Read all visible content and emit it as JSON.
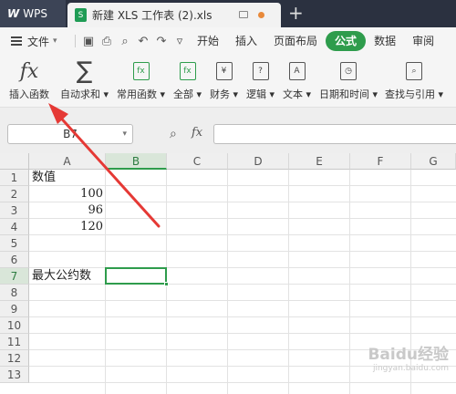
{
  "titlebar": {
    "app_label": "WPS",
    "doc_tab_title": "新建 XLS 工作表 (2).xls",
    "new_tab_symbol": "+"
  },
  "menubar": {
    "file_label": "文件",
    "items": [
      "开始",
      "插入",
      "页面布局",
      "公式",
      "数据",
      "审阅"
    ],
    "active_item": "公式",
    "active_color": "#2e9c4c"
  },
  "ribbon": {
    "buttons": [
      {
        "label": "插入函数",
        "icon": "fx-icon"
      },
      {
        "label": "自动求和",
        "icon": "sigma-icon"
      },
      {
        "label": "常用函数",
        "icon": "common-functions-icon"
      },
      {
        "label": "全部",
        "icon": "all-functions-icon"
      },
      {
        "label": "财务",
        "icon": "finance-icon"
      },
      {
        "label": "逻辑",
        "icon": "logic-icon"
      },
      {
        "label": "文本",
        "icon": "text-icon"
      },
      {
        "label": "日期和时间",
        "icon": "clock-icon"
      },
      {
        "label": "查找与引用",
        "icon": "lookup-icon"
      }
    ]
  },
  "formula_bar": {
    "name_box": "B7",
    "fx_label": "fx",
    "formula": ""
  },
  "sheet": {
    "columns": [
      "A",
      "B",
      "C",
      "D",
      "E",
      "F",
      "G"
    ],
    "rows": [
      "1",
      "2",
      "3",
      "4",
      "5",
      "6",
      "7",
      "8",
      "9",
      "10",
      "11",
      "12",
      "13"
    ],
    "selected_cell": "B7",
    "cells": {
      "A1": "数值",
      "A2": "100",
      "A3": "96",
      "A4": "120",
      "A7": "最大公约数"
    }
  },
  "watermark": {
    "main": "Baidu经验",
    "sub": "jingyan.baidu.com"
  },
  "colors": {
    "annotation_arrow": "#e53935",
    "accent": "#2e9c4c",
    "titlebar": "#2b3140"
  }
}
